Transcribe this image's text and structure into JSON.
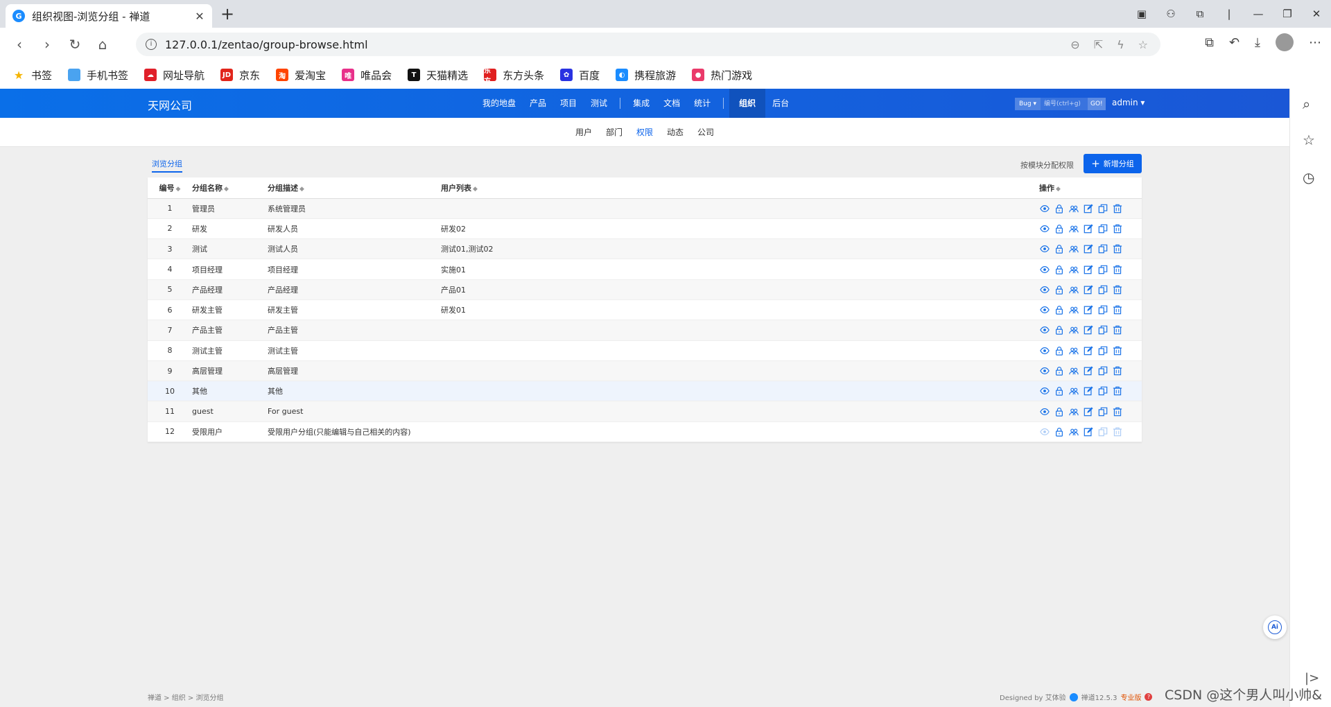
{
  "browser": {
    "tab_title": "组织视图-浏览分组 - 禅道",
    "tab_favicon": "G",
    "close_glyph": "✕",
    "newtab_glyph": "+",
    "url": "127.0.0.1/zentao/group-browse.html",
    "bookmarks": [
      {
        "label": "书签",
        "icon": "star-icon",
        "color": "#f5b400",
        "glyph": "★"
      },
      {
        "label": "手机书签",
        "icon": "phone-icon",
        "color": "#4aa3f0",
        "glyph": ""
      },
      {
        "label": "网址导航",
        "icon": "nav-icon",
        "color": "#e0202a",
        "glyph": "☁"
      },
      {
        "label": "京东",
        "icon": "jd-icon",
        "color": "#e1251b",
        "glyph": "JD"
      },
      {
        "label": "爱淘宝",
        "icon": "taobao-icon",
        "color": "#ff4400",
        "glyph": "淘"
      },
      {
        "label": "唯品会",
        "icon": "vip-icon",
        "color": "#e8308a",
        "glyph": "唯"
      },
      {
        "label": "天猫精选",
        "icon": "tmall-icon",
        "color": "#111111",
        "glyph": "T"
      },
      {
        "label": "东方头条",
        "icon": "toutiao-icon",
        "color": "#e02020",
        "glyph": "东方"
      },
      {
        "label": "百度",
        "icon": "baidu-icon",
        "color": "#2932e1",
        "glyph": "✿"
      },
      {
        "label": "携程旅游",
        "icon": "ctrip-icon",
        "color": "#1a8cff",
        "glyph": "◐"
      },
      {
        "label": "热门游戏",
        "icon": "game-icon",
        "color": "#ea3a6a",
        "glyph": "●"
      }
    ]
  },
  "app": {
    "brand": "天网公司",
    "main_nav": [
      "我的地盘",
      "产品",
      "项目",
      "测试",
      "集成",
      "文档",
      "统计",
      "组织",
      "后台"
    ],
    "main_nav_active": "组织",
    "search": {
      "type": "Bug ▾",
      "placeholder": "编号(ctrl+g)",
      "go": "GO!"
    },
    "user": "admin ▾",
    "sub_nav": [
      "用户",
      "部门",
      "权限",
      "动态",
      "公司"
    ],
    "sub_nav_active": "权限",
    "page_tab": "浏览分组",
    "module_priv": "按模块分配权限",
    "add_group": "新增分组",
    "add_plus": "+",
    "columns": [
      "编号",
      "分组名称",
      "分组描述",
      "用户列表",
      "操作"
    ],
    "sort_glyph": "◆",
    "rows": [
      {
        "id": "1",
        "name": "管理员",
        "desc": "系统管理员",
        "users": ""
      },
      {
        "id": "2",
        "name": "研发",
        "desc": "研发人员",
        "users": "研发02"
      },
      {
        "id": "3",
        "name": "测试",
        "desc": "测试人员",
        "users": "测试01,测试02"
      },
      {
        "id": "4",
        "name": "项目经理",
        "desc": "项目经理",
        "users": "实施01"
      },
      {
        "id": "5",
        "name": "产品经理",
        "desc": "产品经理",
        "users": "产品01"
      },
      {
        "id": "6",
        "name": "研发主管",
        "desc": "研发主管",
        "users": "研发01"
      },
      {
        "id": "7",
        "name": "产品主管",
        "desc": "产品主管",
        "users": ""
      },
      {
        "id": "8",
        "name": "测试主管",
        "desc": "测试主管",
        "users": ""
      },
      {
        "id": "9",
        "name": "高层管理",
        "desc": "高层管理",
        "users": ""
      },
      {
        "id": "10",
        "name": "其他",
        "desc": "其他",
        "users": ""
      },
      {
        "id": "11",
        "name": "guest",
        "desc": "For guest",
        "users": ""
      },
      {
        "id": "12",
        "name": "受限用户",
        "desc": "受限用户分组(只能编辑与自己相关的内容)",
        "users": ""
      }
    ],
    "footer": {
      "crumbs": "禅道 > 组织 > 浏览分组",
      "designed_by": "Designed by 艾体验",
      "version": "禅道12.5.3",
      "edition": "专业版",
      "help": "?"
    },
    "ai_badge": "Ai"
  },
  "colors": {
    "accent": "#0c64eb",
    "topbar": "#0a6fe8",
    "icon": "#1a73e8"
  },
  "watermark": "CSDN @这个男人叫小帅&"
}
